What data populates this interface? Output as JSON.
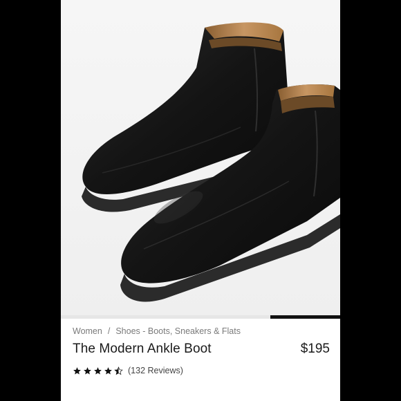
{
  "product": {
    "breadcrumb": [
      "Women",
      "Shoes - Boots, Sneakers & Flats"
    ],
    "breadcrumb_separator": "/",
    "title": "The Modern Ankle Boot",
    "price": "$195",
    "rating": 4.5,
    "rating_max": 5,
    "reviews_label": "(132 Reviews)"
  },
  "carousel": {
    "slide_count": 4,
    "active_slide": 4
  },
  "colors": {
    "boot_leather": "#141414",
    "boot_lining": "#b98a55",
    "background": "#f4f4f4",
    "text_primary": "#1a1a1a",
    "text_secondary": "#7a7a7a",
    "star": "#111111"
  },
  "icons": [
    "star-icon",
    "half-star-icon"
  ]
}
